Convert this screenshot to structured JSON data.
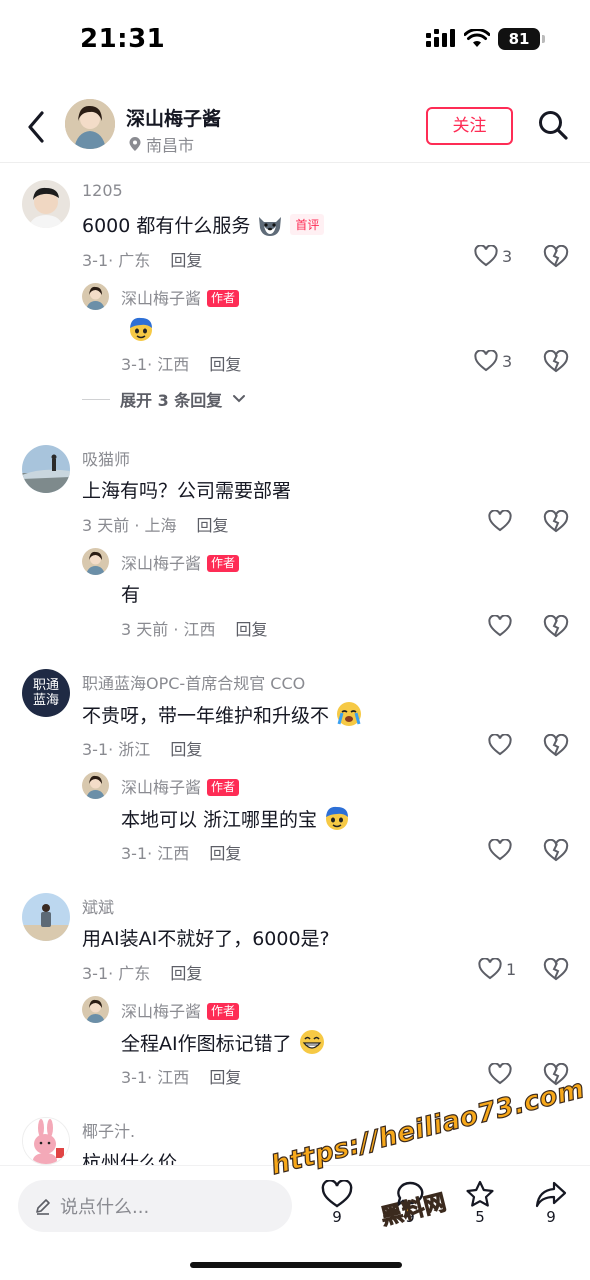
{
  "status": {
    "time": "21:31",
    "battery": "81"
  },
  "header": {
    "name": "深山梅子酱",
    "location": "南昌市",
    "follow_label": "关注"
  },
  "comments": [
    {
      "author": "1205",
      "text": "6000 都有什么服务",
      "badge": "首评",
      "meta": "3-1· 广东",
      "reply_label": "回复",
      "likes": "3"
    },
    {
      "author": "深山梅子酱",
      "badge": "作者",
      "text": "",
      "meta": "3-1· 江西",
      "reply_label": "回复",
      "likes": "3"
    },
    {
      "author": "吸猫师",
      "text": "上海有吗？公司需要部署",
      "meta": "3 天前 · 上海",
      "reply_label": "回复",
      "likes": ""
    },
    {
      "author": "深山梅子酱",
      "badge": "作者",
      "text": "有",
      "meta": "3 天前 · 江西",
      "reply_label": "回复",
      "likes": ""
    },
    {
      "author": "职通蓝海OPC-首席合规官 CCO",
      "text": "不贵呀，带一年维护和升级不",
      "meta": "3-1· 浙江",
      "reply_label": "回复",
      "likes": ""
    },
    {
      "author": "深山梅子酱",
      "badge": "作者",
      "text": "本地可以 浙江哪里的宝",
      "meta": "3-1· 江西",
      "reply_label": "回复",
      "likes": ""
    },
    {
      "author": "斌斌",
      "text": "用AI装AI不就好了，6000是?",
      "meta": "3-1· 广东",
      "reply_label": "回复",
      "likes": "1"
    },
    {
      "author": "深山梅子酱",
      "badge": "作者",
      "text": "全程AI作图标记错了",
      "meta": "3-1· 江西",
      "reply_label": "回复",
      "likes": ""
    },
    {
      "author": "椰子汁.",
      "text": "杭州什么价"
    }
  ],
  "expand_label": "展开 3 条回复",
  "avatar_text": "职通\n蓝海",
  "bottom": {
    "input_placeholder": "说点什么...",
    "like_count": "9",
    "comment_count": "9",
    "star_count": "5",
    "share_count": "9"
  },
  "watermark": {
    "line1": "https://heiliao73.com",
    "line2": "黑料网"
  },
  "colors": {
    "accent": "#fe2c55",
    "text": "#161823",
    "muted": "#8a8b91"
  }
}
